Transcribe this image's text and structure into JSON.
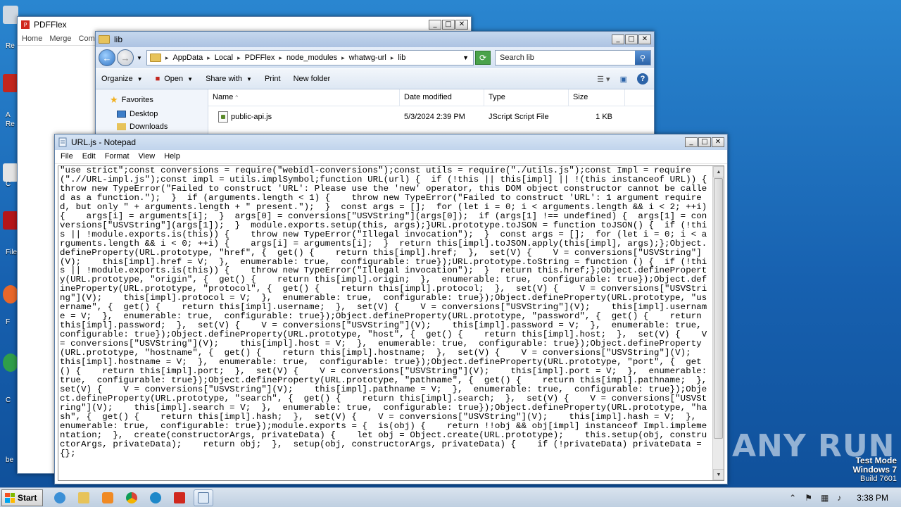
{
  "desktop": {
    "icon_labels": [
      "Re",
      "A",
      "Re",
      "C",
      "File",
      "F",
      "C",
      "be"
    ]
  },
  "pdfflex": {
    "title": "PDFFlex",
    "menu": [
      "Home",
      "Merge",
      "Com"
    ]
  },
  "explorer": {
    "title": "lib",
    "breadcrumb": [
      "AppData",
      "Local",
      "PDFFlex",
      "node_modules",
      "whatwg-url",
      "lib"
    ],
    "search_placeholder": "Search lib",
    "toolbar": {
      "organize": "Organize",
      "open": "Open",
      "share_with": "Share with",
      "print": "Print",
      "new_folder": "New folder"
    },
    "nav": {
      "favorites": "Favorites",
      "desktop": "Desktop",
      "downloads": "Downloads"
    },
    "columns": {
      "name": "Name",
      "date_modified": "Date modified",
      "type": "Type",
      "size": "Size"
    },
    "files": [
      {
        "name": "public-api.js",
        "date": "5/3/2024 2:39 PM",
        "type": "JScript Script File",
        "size": "1 KB"
      }
    ]
  },
  "notepad": {
    "title": "URL.js - Notepad",
    "menu": [
      "File",
      "Edit",
      "Format",
      "View",
      "Help"
    ],
    "content": "\"use strict\";const conversions = require(\"webidl-conversions\");const utils = require(\"./utils.js\");const Impl = require(\".//URL-impl.js\");const impl = utils.implSymbol;function URL(url) {  if (!this || this[impl] || !(this instanceof URL)) {    throw new TypeError(\"Failed to construct 'URL': Please use the 'new' operator, this DOM object constructor cannot be called as a function.\");  }  if (arguments.length < 1) {    throw new TypeError(\"Failed to construct 'URL': 1 argument required, but only \" + arguments.length + \" present.\");  }  const args = [];  for (let i = 0; i < arguments.length && i < 2; ++i) {    args[i] = arguments[i];  }  args[0] = conversions[\"USVString\"](args[0]);  if (args[1] !== undefined) {  args[1] = conversions[\"USVString\"](args[1]);  }  module.exports.setup(this, args);}URL.prototype.toJSON = function toJSON() {  if (!this || !module.exports.is(this)) {    throw new TypeError(\"Illegal invocation\");  }  const args = [];  for (let i = 0; i < arguments.length && i < 0; ++i) {    args[i] = arguments[i];  }  return this[impl].toJSON.apply(this[impl], args);};Object.defineProperty(URL.prototype, \"href\", {  get() {    return this[impl].href;  },  set(V) {    V = conversions[\"USVString\"](V);    this[impl].href = V;  },  enumerable: true,  configurable: true});URL.prototype.toString = function () {  if (!this || !module.exports.is(this)) {    throw new TypeError(\"Illegal invocation\");  }  return this.href;};Object.defineProperty(URL.prototype, \"origin\", {  get() {    return this[impl].origin;  },  enumerable: true,  configurable: true});Object.defineProperty(URL.prototype, \"protocol\", {  get() {    return this[impl].protocol;  },  set(V) {    V = conversions[\"USVString\"](V);    this[impl].protocol = V;  },  enumerable: true,  configurable: true});Object.defineProperty(URL.prototype, \"username\", {  get() {    return this[impl].username;  },  set(V) {    V = conversions[\"USVString\"](V);    this[impl].username = V;  },  enumerable: true,  configurable: true});Object.defineProperty(URL.prototype, \"password\", {  get() {    return this[impl].password;  },  set(V) {    V = conversions[\"USVString\"](V);    this[impl].password = V;  },  enumerable: true,  configurable: true});Object.defineProperty(URL.prototype, \"host\", {  get() {    return this[impl].host;  },  set(V) {    V = conversions[\"USVString\"](V);    this[impl].host = V;  },  enumerable: true,  configurable: true});Object.defineProperty(URL.prototype, \"hostname\", {  get() {    return this[impl].hostname;  },  set(V) {    V = conversions[\"USVString\"](V);    this[impl].hostname = V;  },  enumerable: true,  configurable: true});Object.defineProperty(URL.prototype, \"port\", {  get() {    return this[impl].port;  },  set(V) {    V = conversions[\"USVString\"](V);    this[impl].port = V;  },  enumerable: true,  configurable: true});Object.defineProperty(URL.prototype, \"pathname\", {  get() {    return this[impl].pathname;  },  set(V) {    V = conversions[\"USVString\"](V);    this[impl].pathname = V;  },  enumerable: true,  configurable: true});Object.defineProperty(URL.prototype, \"search\", {  get() {    return this[impl].search;  },  set(V) {    V = conversions[\"USVString\"](V);    this[impl].search = V;  },  enumerable: true,  configurable: true});Object.defineProperty(URL.prototype, \"hash\", {  get() {    return this[impl].hash;  },  set(V) {    V = conversions[\"USVString\"](V);    this[impl].hash = V;  },  enumerable: true,  configurable: true});module.exports = {  is(obj) {    return !!obj && obj[impl] instanceof Impl.implementation;  },  create(constructorArgs, privateData) {    let obj = Object.create(URL.prototype);    this.setup(obj, constructorArgs, privateData);    return obj;  },  setup(obj, constructorArgs, privateData) {    if (!privateData) privateData = {};"
  },
  "watermark": "ANY RUN",
  "os_info": {
    "line1": "Test Mode",
    "line2": "Windows 7",
    "line3": "Build 7601"
  },
  "taskbar": {
    "start_label": "Start",
    "clock": "3:38 PM"
  },
  "colors": {
    "desktop_bg": "#1b6ab8",
    "titlebar_active": "#c1d4ec"
  }
}
